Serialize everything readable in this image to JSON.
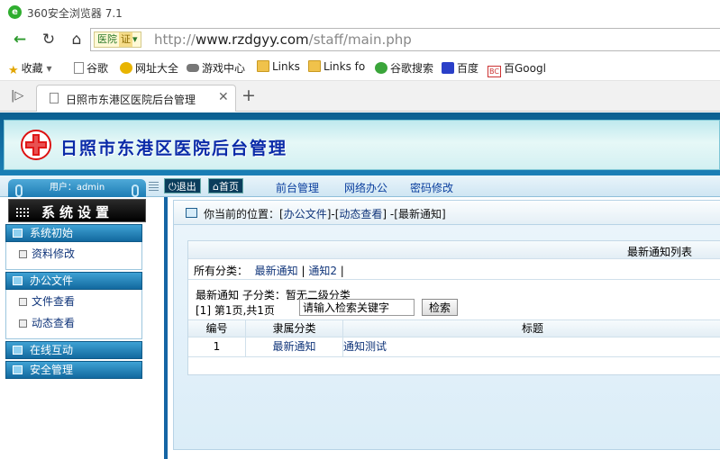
{
  "browser": {
    "window_title": "360安全浏览器 7.1",
    "identity_label": "医院",
    "cert_label": "证",
    "url_scheme": "http://",
    "url_host": "www.rzdgyy.com",
    "url_path": "/staff/main.php",
    "favorites": [
      {
        "label": "收藏",
        "icon": "star-icon"
      },
      {
        "label": "谷歌",
        "icon": "page-icon"
      },
      {
        "label": "网址大全",
        "icon": "globe-icon"
      },
      {
        "label": "游戏中心",
        "icon": "gamepad-icon"
      },
      {
        "label": "Links",
        "icon": "folder-icon"
      },
      {
        "label": "Links fo",
        "icon": "folder-icon"
      },
      {
        "label": "谷歌搜索",
        "icon": "search-360-icon"
      },
      {
        "label": "百度",
        "icon": "baidu-icon"
      },
      {
        "label": "百Googl",
        "icon": "bc-icon"
      }
    ],
    "tab_title": "日照市东港区医院后台管理"
  },
  "app": {
    "banner_title": "日照市东港区医院后台管理",
    "user_label": "用户：admin",
    "sys_title": "系统设置",
    "topmenu": {
      "logout": "退出",
      "home": "首页",
      "links": [
        "前台管理",
        "网络办公",
        "密码修改"
      ]
    },
    "nav": [
      {
        "label": "系统初始",
        "items": [
          "资料修改"
        ]
      },
      {
        "label": "办公文件",
        "items": [
          "文件查看",
          "动态查看"
        ]
      },
      {
        "label": "在线互动",
        "items": []
      },
      {
        "label": "安全管理",
        "items": []
      }
    ],
    "breadcrumb": {
      "prefix": "你当前的位置：[",
      "part1": "办公文件",
      "sep1": "]-[",
      "part2": "动态查看",
      "sep2": "] -[",
      "part3": "最新通知",
      "suffix": "]"
    },
    "list_title": "最新通知列表",
    "categories_label": "所有分类：",
    "categories": [
      "最新通知",
      "通知2"
    ],
    "subcat_text": "最新通知 子分类：暂无二级分类",
    "pager_text": "[1] 第1页,共1页",
    "search": {
      "value": "请输入检索关键字",
      "button": "检索"
    },
    "columns": [
      "编号",
      "隶属分类",
      "标题"
    ],
    "rows": [
      {
        "id": "1",
        "category": "最新通知",
        "title": "通知测试"
      }
    ]
  },
  "colors": {
    "banner_blue": "#1b7fb6",
    "title_blue": "#0a2aa8",
    "link_blue": "#10357a",
    "nav_blue": "#12699f"
  }
}
